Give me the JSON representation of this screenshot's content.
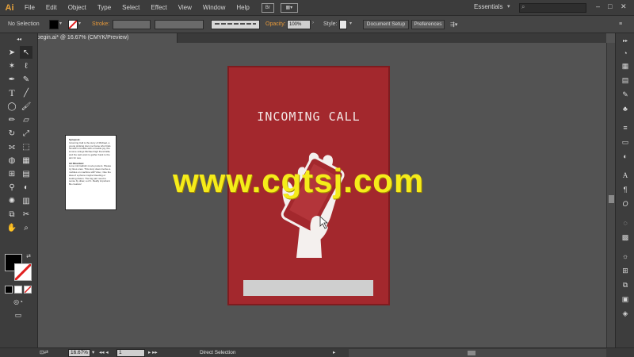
{
  "app": {
    "logo": "Ai"
  },
  "menu": [
    "File",
    "Edit",
    "Object",
    "Type",
    "Select",
    "Effect",
    "View",
    "Window",
    "Help"
  ],
  "menu_icons": {
    "bridge": "Br"
  },
  "workspace": {
    "label": "Essentials"
  },
  "controlbar": {
    "selection": "No Selection",
    "stroke_label": "Stroke:",
    "opacity_label": "Opacity:",
    "opacity_value": "100%",
    "style_label": "Style:",
    "document_setup": "Document Setup",
    "preferences": "Preferences"
  },
  "document": {
    "tab_title": "07_begin.ai* @ 16.67% (CMYK/Preview)",
    "close": "×"
  },
  "small_document": {
    "heading1": "Synopsis:",
    "body1": "Incoming Call is the story of Michael, a young stinking clan me frame who finds himself in trouble with a trouble joy, the income strings Michael high friend Ellie and the web want to gather back to the aim for sea.",
    "heading2": "Art Direction:",
    "body2": "Love minimalistic movie posters. Please try lines ones. This story does involve a mobiles on machine still? Also, I like the idea of a phone maybe bleeding or looking drawn. The big part need to sense by draw, a of it. Really important. Be creative!"
  },
  "poster": {
    "title": "INCOMING CALL",
    "bg_color": "#a3282d"
  },
  "watermark": {
    "text": "www.cgtsj.com"
  },
  "status": {
    "zoom": "16.67%",
    "page": "1",
    "tool": "Direct Selection"
  }
}
